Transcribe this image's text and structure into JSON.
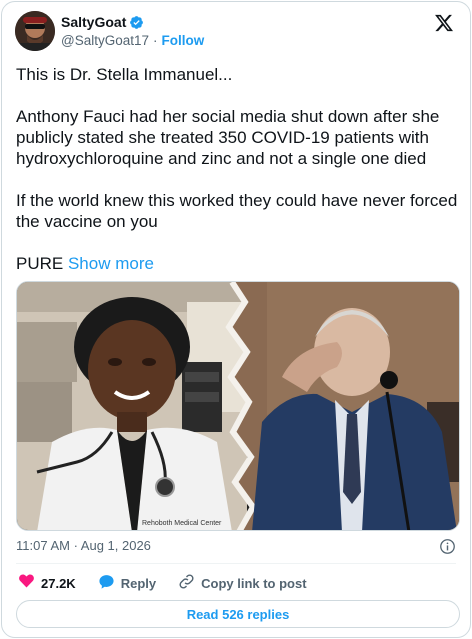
{
  "author": {
    "display_name": "SaltyGoat",
    "handle": "@SaltyGoat17",
    "separator": "·",
    "follow_label": "Follow"
  },
  "tweet": {
    "lines": [
      "This is Dr. Stella Immanuel...",
      "Anthony Fauci had her social media shut down after she publicly stated she treated 350 COVID-19 patients with hydroxychloroquine and zinc and not a single one died",
      "If the world knew this worked they could have never forced the vaccine on you"
    ],
    "last_line_prefix": "PURE",
    "show_more_label": "Show more"
  },
  "media": {
    "coat_text": "Rehoboth Medical Center"
  },
  "meta": {
    "timestamp": "11:07 AM · Aug 1, 2026"
  },
  "actions": {
    "like_count": "27.2K",
    "reply_label": "Reply",
    "copy_label": "Copy link to post"
  },
  "replies_button": {
    "label": "Read 526 replies"
  },
  "colors": {
    "accent": "#1d9bf0",
    "like": "#f91880",
    "muted": "#536471"
  },
  "icons": [
    "verified-badge-icon",
    "x-logo-icon",
    "info-icon",
    "heart-icon",
    "reply-icon",
    "link-icon"
  ]
}
